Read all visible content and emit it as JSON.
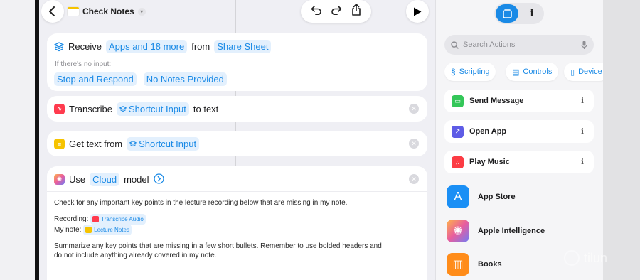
{
  "header": {
    "title": "Check Notes",
    "back_icon": "chevron-left-icon",
    "undo_icon": "undo-icon",
    "redo_icon": "redo-icon",
    "share_icon": "share-icon",
    "run_icon": "play-icon"
  },
  "actions": {
    "receive": {
      "label": "Receive",
      "types": "Apps and 18 more",
      "from": "from",
      "source": "Share Sheet",
      "no_input_label": "If there's no input:",
      "no_input_action": "Stop and Respond",
      "no_input_notes": "No Notes Provided"
    },
    "transcribe": {
      "label": "Transcribe",
      "input": "Shortcut Input",
      "suffix": "to text"
    },
    "get_text": {
      "label": "Get text from",
      "input": "Shortcut Input"
    },
    "model": {
      "label": "Use",
      "model": "Cloud",
      "suffix": "model",
      "prompt_line1": "Check for any important key points in the lecture recording below that are missing in my note.",
      "recording_label": "Recording:",
      "recording_value": "Transcribe Audio",
      "note_label": "My note:",
      "note_value": "Lecture Notes",
      "prompt_line2": "Summarize any key points that are missing in a few short bullets. Remember to use bolded headers and",
      "prompt_line3": "do not include anything already covered in my note."
    }
  },
  "sidebar": {
    "tab_icons": [
      "library-icon",
      "info-icon"
    ],
    "tab_info": "i",
    "search_placeholder": "Search Actions",
    "categories": [
      "Scripting",
      "Controls",
      "Device"
    ],
    "suggestions": [
      {
        "label": "Send Message",
        "color": "#34c759"
      },
      {
        "label": "Open App",
        "color": "#5e5ce6"
      },
      {
        "label": "Play Music",
        "color": "#fc3c44"
      }
    ],
    "apps": [
      {
        "label": "App Store",
        "color": "#1a8ff5"
      },
      {
        "label": "Apple Intelligence",
        "color": "#e85d9e"
      },
      {
        "label": "Books",
        "color": "#ff8c1a"
      }
    ],
    "info_glyph": "i"
  },
  "watermark": "tilun",
  "colors": {
    "accent": "#1a8ae6",
    "token_bg": "#e3f0fd",
    "transcribe": "#ff3b4e",
    "get_text": "#f6c300",
    "run_button": "#000000"
  }
}
